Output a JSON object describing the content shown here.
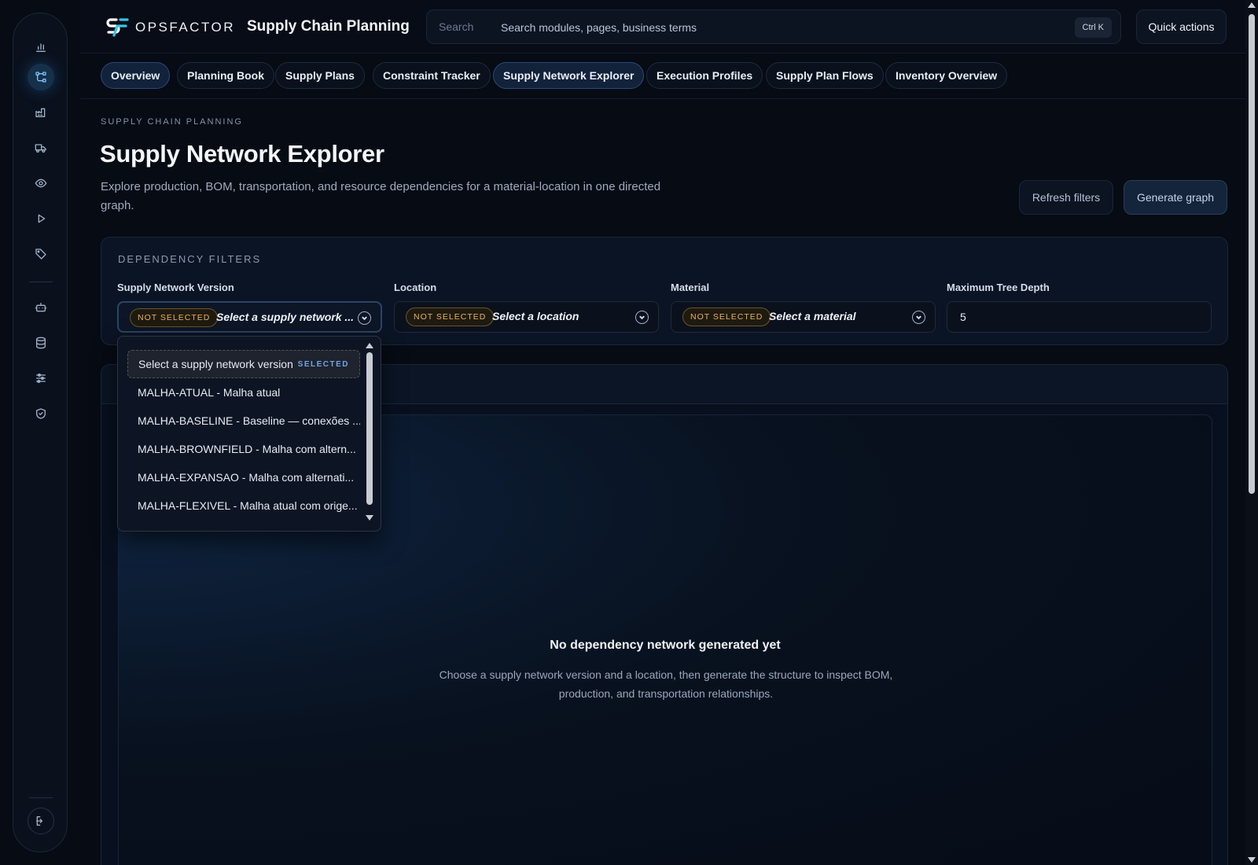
{
  "brand": {
    "name": "OPSFACTOR",
    "module": "Supply Chain Planning"
  },
  "search": {
    "label": "Search",
    "placeholder": "Search modules, pages, business terms",
    "shortcut": "Ctrl K"
  },
  "quick_actions": "Quick actions",
  "tabs": [
    {
      "label": "Overview",
      "active": true
    },
    {
      "label": "Planning Book",
      "active": false
    },
    {
      "label": "Supply Plans",
      "active": false
    },
    {
      "label": "Constraint Tracker",
      "active": false
    },
    {
      "label": "Supply Network Explorer",
      "active": true
    },
    {
      "label": "Execution Profiles",
      "active": false
    },
    {
      "label": "Supply Plan Flows",
      "active": false
    },
    {
      "label": "Inventory Overview",
      "active": false
    }
  ],
  "sidebar": {
    "icons": [
      "bar-chart-icon",
      "network-icon",
      "factory-icon",
      "truck-icon",
      "eye-icon",
      "play-icon",
      "tag-icon",
      "robot-icon",
      "database-icon",
      "sliders-icon",
      "shield-icon"
    ],
    "footer_icon": "logout-icon"
  },
  "page": {
    "eyebrow": "SUPPLY CHAIN PLANNING",
    "title": "Supply Network Explorer",
    "description": "Explore production, BOM, transportation, and resource dependencies for a material-location in one directed graph.",
    "refresh_label": "Refresh filters",
    "generate_label": "Generate graph"
  },
  "filters": {
    "title": "DEPENDENCY FILTERS",
    "supply_network_version": {
      "label": "Supply Network Version",
      "badge": "NOT SELECTED",
      "value": "Select a supply network ..."
    },
    "location": {
      "label": "Location",
      "badge": "NOT SELECTED",
      "value": "Select a location"
    },
    "material": {
      "label": "Material",
      "badge": "NOT SELECTED",
      "value": "Select a material"
    },
    "max_depth": {
      "label": "Maximum Tree Depth",
      "value": "5"
    }
  },
  "dropdown": {
    "selected_tag": "SELECTED",
    "options": [
      "Select a supply network version",
      "MALHA-ATUAL - Malha atual",
      "MALHA-BASELINE - Baseline — conexões ...",
      "MALHA-BROWNFIELD - Malha com altern...",
      "MALHA-EXPANSAO - Malha com alternati...",
      "MALHA-FLEXIVEL - Malha atual com orige..."
    ]
  },
  "empty_state": {
    "title": "No dependency network generated yet",
    "description": "Choose a supply network version and a location, then generate the structure to inspect BOM, production, and transportation relationships."
  },
  "colors": {
    "accent": "#7fc3ff",
    "badge": "#e6b35c",
    "background": "#060b14"
  }
}
